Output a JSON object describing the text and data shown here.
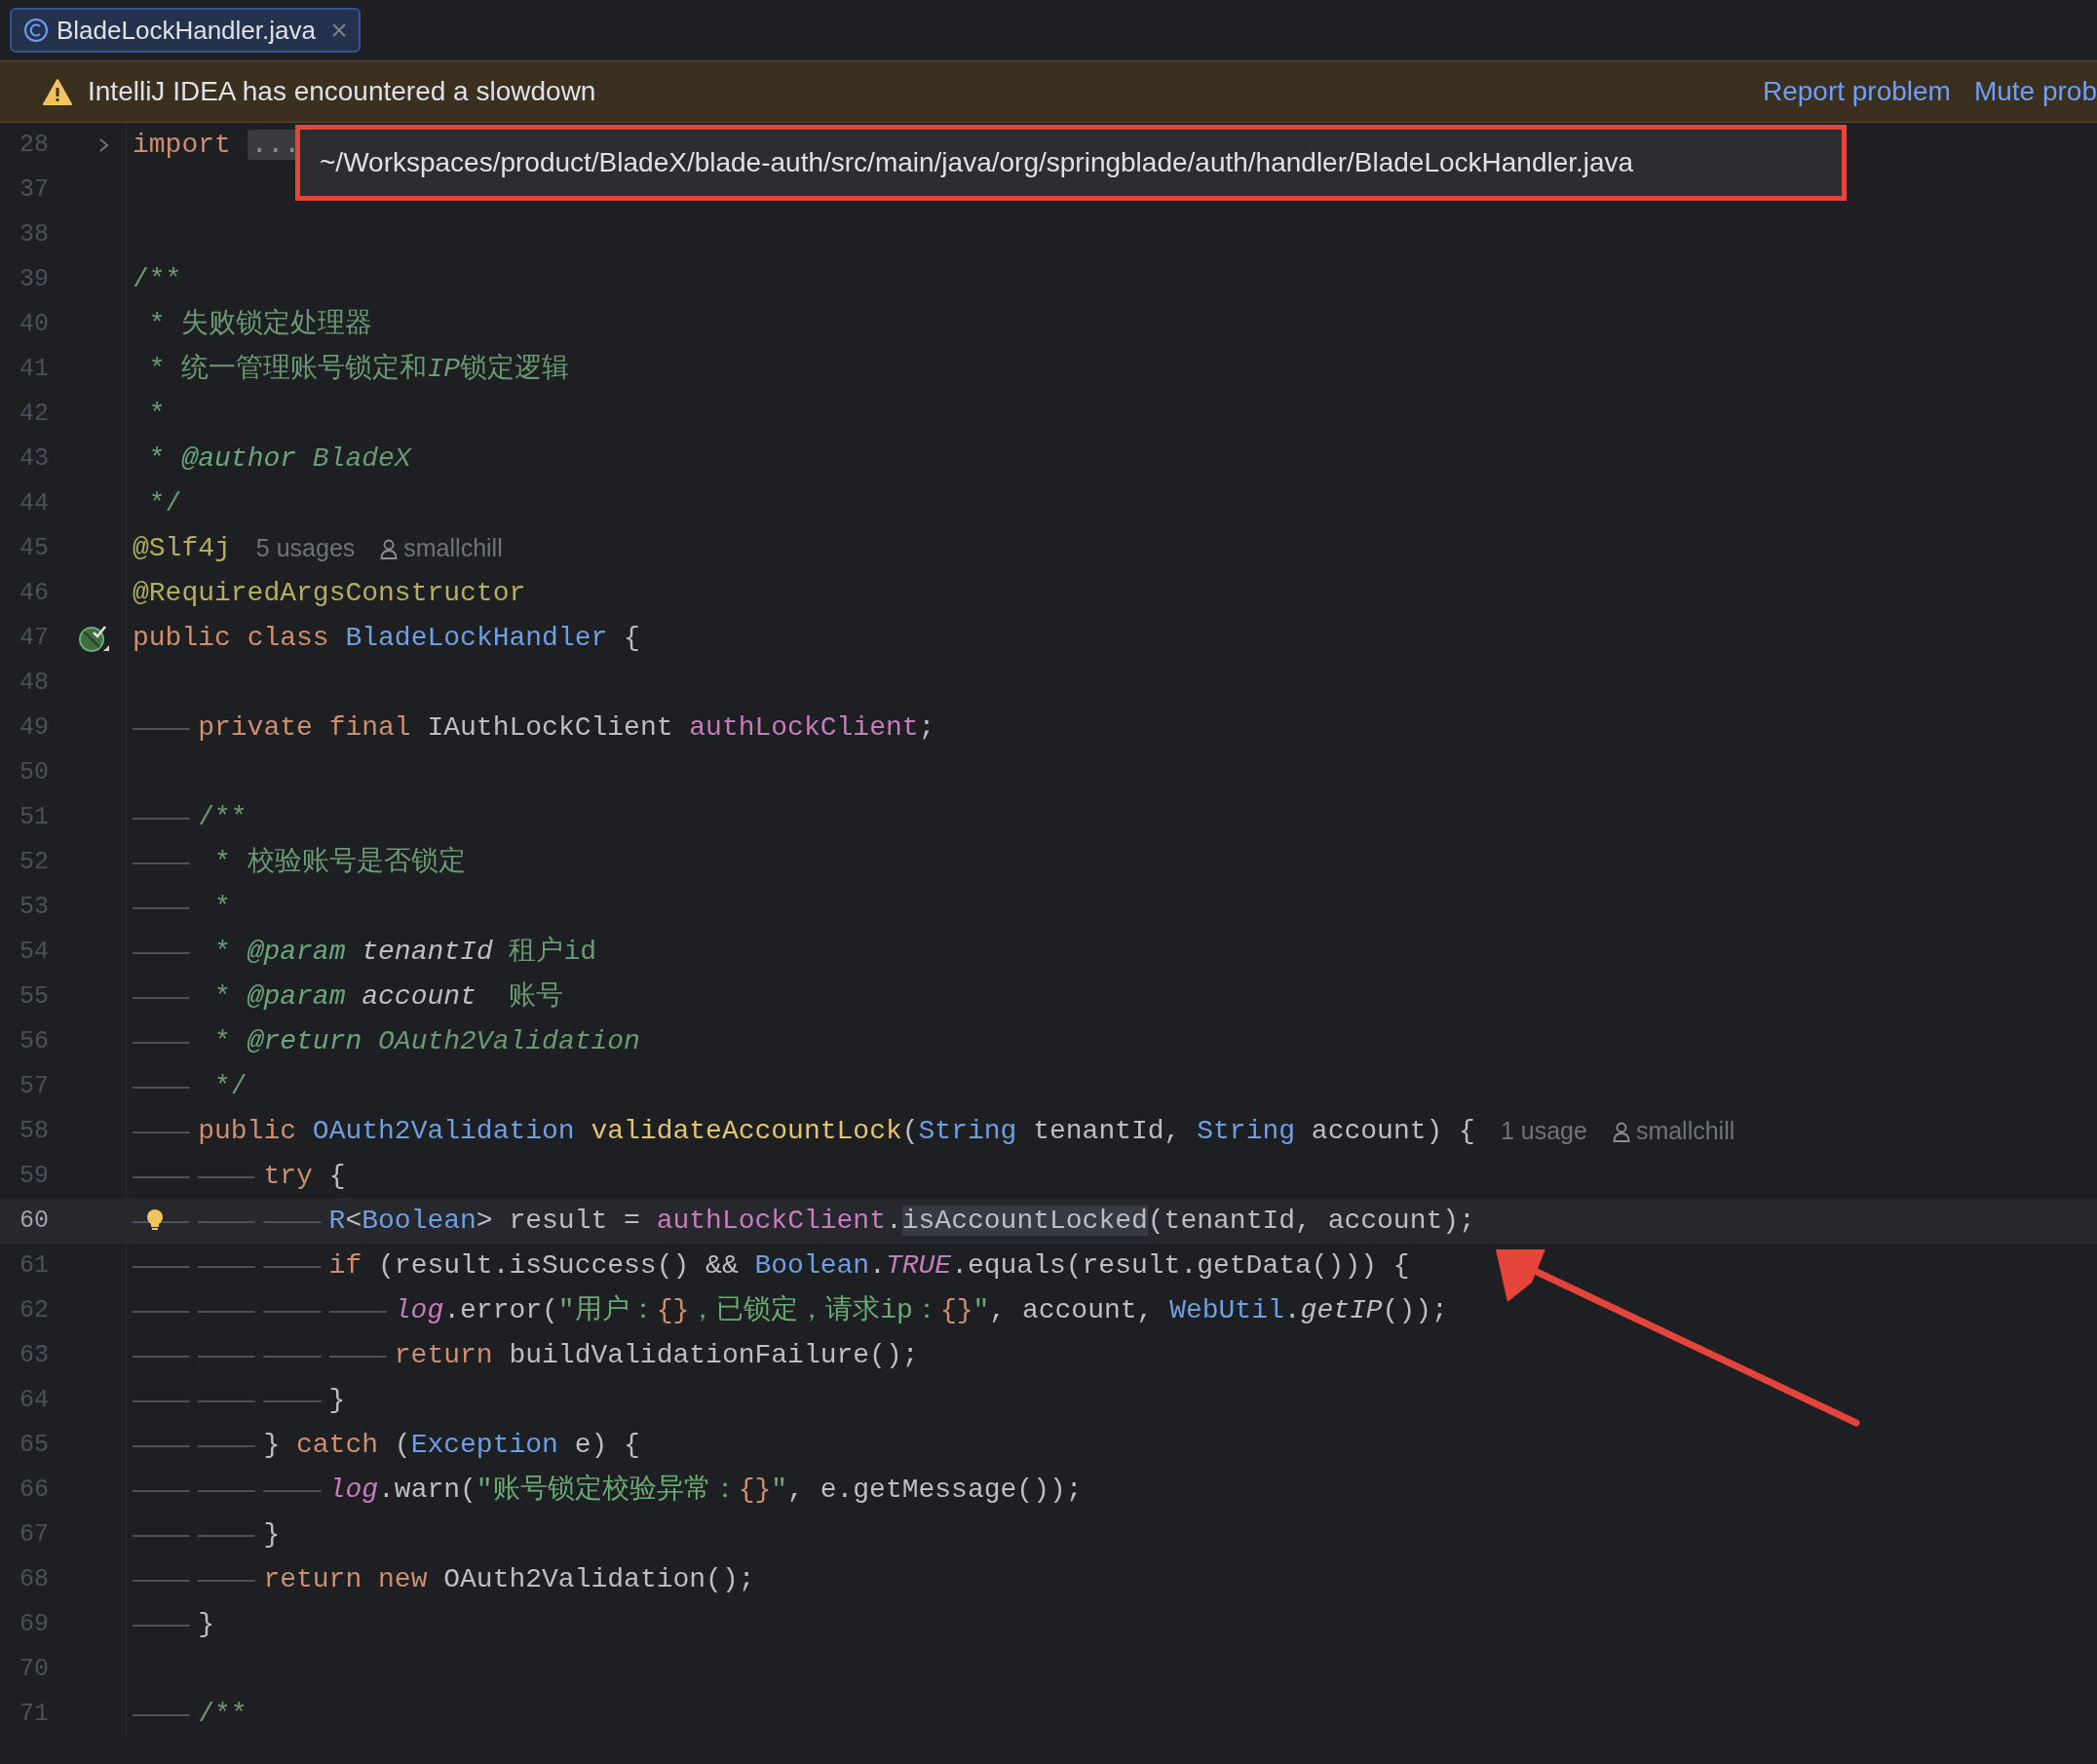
{
  "tab": {
    "title": "BladeLockHandler.java",
    "selected": true
  },
  "banner": {
    "message": "IntelliJ IDEA has encountered a slowdown",
    "actions": [
      "Report problem",
      "Mute prob"
    ]
  },
  "tooltip": {
    "path": "~/Workspaces/product/BladeX/blade-auth/src/main/java/org/springblade/auth/handler/BladeLockHandler.java"
  },
  "editor": {
    "lines": [
      {
        "number": "28",
        "gutter": {
          "kind": "fold"
        },
        "code": [
          {
            "kind": "kw",
            "text": "import "
          },
          {
            "kind": "fold",
            "text": "..."
          }
        ]
      },
      {
        "number": "37"
      },
      {
        "number": "38"
      },
      {
        "number": "39",
        "code": [
          {
            "kind": "cm",
            "text": "/**"
          }
        ]
      },
      {
        "number": "40",
        "code": [
          {
            "kind": "cm",
            "text": " * 失败锁定处理器"
          }
        ]
      },
      {
        "number": "41",
        "code": [
          {
            "kind": "cm",
            "text": " * 统一管理账号锁定和"
          },
          {
            "kind": "cmi",
            "text": "IP"
          },
          {
            "kind": "cm",
            "text": "锁定逻辑"
          }
        ]
      },
      {
        "number": "42",
        "code": [
          {
            "kind": "cm",
            "text": " *"
          }
        ]
      },
      {
        "number": "43",
        "code": [
          {
            "kind": "cm",
            "text": " * "
          },
          {
            "kind": "doctag",
            "text": "@author"
          },
          {
            "kind": "cmi",
            "text": " BladeX"
          }
        ]
      },
      {
        "number": "44",
        "code": [
          {
            "kind": "cm",
            "text": " */"
          }
        ]
      },
      {
        "number": "45",
        "code": [
          {
            "kind": "ann",
            "text": "@Slf4j"
          }
        ],
        "hints": [
          {
            "kind": "usages",
            "text": "5 usages"
          },
          {
            "kind": "author",
            "text": "smallchill"
          }
        ]
      },
      {
        "number": "46",
        "code": [
          {
            "kind": "ann",
            "text": "@RequiredArgsConstructor"
          }
        ]
      },
      {
        "number": "47",
        "gutter": {
          "kind": "class-marker"
        },
        "code": [
          {
            "kind": "kw",
            "text": "public "
          },
          {
            "kind": "kw",
            "text": "class "
          },
          {
            "kind": "type",
            "text": "BladeLockHandler"
          },
          {
            "kind": "plain",
            "text": " {"
          }
        ]
      },
      {
        "number": "48"
      },
      {
        "number": "49",
        "code": [
          {
            "kind": "tab"
          },
          {
            "kind": "kw",
            "text": "private "
          },
          {
            "kind": "kw",
            "text": "final "
          },
          {
            "kind": "plain",
            "text": "IAuthLockClient "
          },
          {
            "kind": "field",
            "text": "authLockClient"
          },
          {
            "kind": "plain",
            "text": ";"
          }
        ]
      },
      {
        "number": "50"
      },
      {
        "number": "51",
        "code": [
          {
            "kind": "tab"
          },
          {
            "kind": "cm",
            "text": "/**"
          }
        ]
      },
      {
        "number": "52",
        "code": [
          {
            "kind": "tab"
          },
          {
            "kind": "cm",
            "text": " * 校验账号是否锁定"
          }
        ]
      },
      {
        "number": "53",
        "code": [
          {
            "kind": "tab"
          },
          {
            "kind": "cm",
            "text": " *"
          }
        ]
      },
      {
        "number": "54",
        "code": [
          {
            "kind": "tab"
          },
          {
            "kind": "cm",
            "text": " * "
          },
          {
            "kind": "doctag",
            "text": "@param"
          },
          {
            "kind": "docparam",
            "text": " tenantId"
          },
          {
            "kind": "cm",
            "text": " 租户id"
          }
        ]
      },
      {
        "number": "55",
        "code": [
          {
            "kind": "tab"
          },
          {
            "kind": "cm",
            "text": " * "
          },
          {
            "kind": "doctag",
            "text": "@param"
          },
          {
            "kind": "docparam",
            "text": " account"
          },
          {
            "kind": "cm",
            "text": "  账号"
          }
        ]
      },
      {
        "number": "56",
        "code": [
          {
            "kind": "tab"
          },
          {
            "kind": "cm",
            "text": " * "
          },
          {
            "kind": "doctag",
            "text": "@return"
          },
          {
            "kind": "cmi",
            "text": " OAuth2Validation"
          }
        ]
      },
      {
        "number": "57",
        "code": [
          {
            "kind": "tab"
          },
          {
            "kind": "cm",
            "text": " */"
          }
        ]
      },
      {
        "number": "58",
        "code": [
          {
            "kind": "tab"
          },
          {
            "kind": "kw",
            "text": "public "
          },
          {
            "kind": "type",
            "text": "OAuth2Validation "
          },
          {
            "kind": "method",
            "text": "validateAccountLock"
          },
          {
            "kind": "plain",
            "text": "("
          },
          {
            "kind": "type",
            "text": "String"
          },
          {
            "kind": "plain",
            "text": " tenantId, "
          },
          {
            "kind": "type",
            "text": "String"
          },
          {
            "kind": "plain",
            "text": " account) {"
          }
        ],
        "hints": [
          {
            "kind": "usages",
            "text": "1 usage"
          },
          {
            "kind": "author",
            "text": "smallchill"
          }
        ]
      },
      {
        "number": "59",
        "code": [
          {
            "kind": "tab"
          },
          {
            "kind": "tab"
          },
          {
            "kind": "kw",
            "text": "try"
          },
          {
            "kind": "plain",
            "text": " {"
          }
        ]
      },
      {
        "number": "60",
        "current": true,
        "gutter": {
          "kind": "bulb"
        },
        "code": [
          {
            "kind": "tab"
          },
          {
            "kind": "tab"
          },
          {
            "kind": "tab"
          },
          {
            "kind": "type",
            "text": "R"
          },
          {
            "kind": "plain",
            "text": "<"
          },
          {
            "kind": "type",
            "text": "Boolean"
          },
          {
            "kind": "plain",
            "text": "> result = "
          },
          {
            "kind": "field",
            "text": "authLockClient"
          },
          {
            "kind": "plain",
            "text": "."
          },
          {
            "kind": "hl",
            "text": "isAccountLocked"
          },
          {
            "kind": "plain",
            "text": "(tenantId, account);"
          }
        ]
      },
      {
        "number": "61",
        "code": [
          {
            "kind": "tab"
          },
          {
            "kind": "tab"
          },
          {
            "kind": "tab"
          },
          {
            "kind": "kw",
            "text": "if"
          },
          {
            "kind": "plain",
            "text": " (result.isSuccess() && "
          },
          {
            "kind": "type",
            "text": "Boolean"
          },
          {
            "kind": "plain",
            "text": "."
          },
          {
            "kind": "sfield",
            "text": "TRUE"
          },
          {
            "kind": "plain",
            "text": ".equals(result.getData())) {"
          }
        ]
      },
      {
        "number": "62",
        "code": [
          {
            "kind": "tab"
          },
          {
            "kind": "tab"
          },
          {
            "kind": "tab"
          },
          {
            "kind": "tab"
          },
          {
            "kind": "sfield",
            "text": "log"
          },
          {
            "kind": "plain",
            "text": ".error("
          },
          {
            "kind": "str",
            "text": "\"用户："
          },
          {
            "kind": "fmt",
            "text": "{}"
          },
          {
            "kind": "str",
            "text": "，已锁定，请求ip："
          },
          {
            "kind": "fmt",
            "text": "{}"
          },
          {
            "kind": "str",
            "text": "\""
          },
          {
            "kind": "plain",
            "text": ", account, "
          },
          {
            "kind": "type",
            "text": "WebUtil"
          },
          {
            "kind": "plain",
            "text": "."
          },
          {
            "kind": "smethod",
            "text": "getIP"
          },
          {
            "kind": "plain",
            "text": "());"
          }
        ]
      },
      {
        "number": "63",
        "code": [
          {
            "kind": "tab"
          },
          {
            "kind": "tab"
          },
          {
            "kind": "tab"
          },
          {
            "kind": "tab"
          },
          {
            "kind": "kw",
            "text": "return"
          },
          {
            "kind": "plain",
            "text": " buildValidationFailure();"
          }
        ]
      },
      {
        "number": "64",
        "code": [
          {
            "kind": "tab"
          },
          {
            "kind": "tab"
          },
          {
            "kind": "tab"
          },
          {
            "kind": "plain",
            "text": "}"
          }
        ]
      },
      {
        "number": "65",
        "code": [
          {
            "kind": "tab"
          },
          {
            "kind": "tab"
          },
          {
            "kind": "plain",
            "text": "} "
          },
          {
            "kind": "kw",
            "text": "catch"
          },
          {
            "kind": "plain",
            "text": " ("
          },
          {
            "kind": "type",
            "text": "Exception"
          },
          {
            "kind": "plain",
            "text": " e) {"
          }
        ]
      },
      {
        "number": "66",
        "code": [
          {
            "kind": "tab"
          },
          {
            "kind": "tab"
          },
          {
            "kind": "tab"
          },
          {
            "kind": "sfield",
            "text": "log"
          },
          {
            "kind": "plain",
            "text": ".warn("
          },
          {
            "kind": "str",
            "text": "\"账号锁定校验异常："
          },
          {
            "kind": "fmt",
            "text": "{}"
          },
          {
            "kind": "str",
            "text": "\""
          },
          {
            "kind": "plain",
            "text": ", e.getMessage());"
          }
        ]
      },
      {
        "number": "67",
        "code": [
          {
            "kind": "tab"
          },
          {
            "kind": "tab"
          },
          {
            "kind": "plain",
            "text": "}"
          }
        ]
      },
      {
        "number": "68",
        "code": [
          {
            "kind": "tab"
          },
          {
            "kind": "tab"
          },
          {
            "kind": "kw",
            "text": "return "
          },
          {
            "kind": "kw",
            "text": "new "
          },
          {
            "kind": "plain",
            "text": "OAuth2Validation();"
          }
        ]
      },
      {
        "number": "69",
        "code": [
          {
            "kind": "tab"
          },
          {
            "kind": "plain",
            "text": "}"
          }
        ]
      },
      {
        "number": "70"
      },
      {
        "number": "71",
        "code": [
          {
            "kind": "tab"
          },
          {
            "kind": "cm",
            "text": "/**"
          }
        ]
      }
    ]
  }
}
